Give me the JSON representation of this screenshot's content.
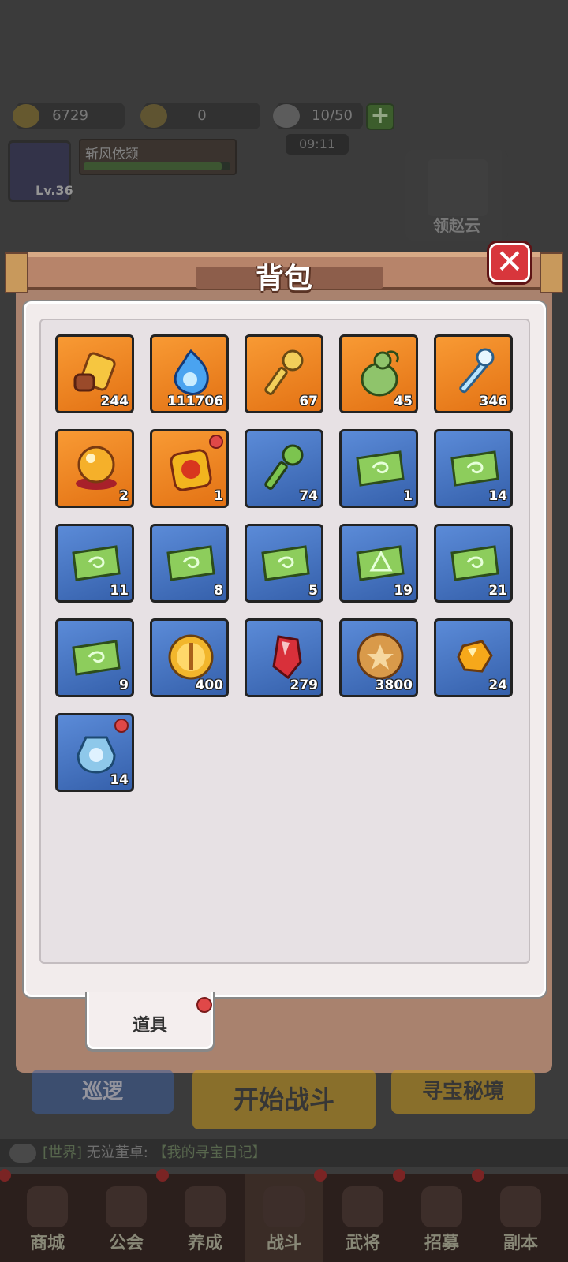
{
  "resources": {
    "gold": "6729",
    "ingot": "0",
    "stamina": "10/50",
    "timer": "09:11"
  },
  "player": {
    "level": "Lv.36",
    "name": "斩风依颖"
  },
  "hero": {
    "name": "领赵云"
  },
  "panel": {
    "title": "背包",
    "close_label": "✕",
    "tab_label": "道具"
  },
  "items": [
    {
      "icon": "golden-seal-icon",
      "qty": "244",
      "rarity": "orange",
      "has_dot": false
    },
    {
      "icon": "blue-spirit-flame-icon",
      "qty": "111706",
      "rarity": "orange",
      "has_dot": false
    },
    {
      "icon": "golden-key-icon",
      "qty": "67",
      "rarity": "orange",
      "has_dot": false
    },
    {
      "icon": "green-gourd-icon",
      "qty": "45",
      "rarity": "orange",
      "has_dot": false
    },
    {
      "icon": "ice-scepter-key-icon",
      "qty": "346",
      "rarity": "orange",
      "has_dot": false
    },
    {
      "icon": "fire-orb-icon",
      "qty": "2",
      "rarity": "orange",
      "has_dot": false
    },
    {
      "icon": "lucky-pouch-icon",
      "qty": "1",
      "rarity": "orange",
      "has_dot": true
    },
    {
      "icon": "jade-key-icon",
      "qty": "74",
      "rarity": "blue",
      "has_dot": false
    },
    {
      "icon": "green-scroll-icon",
      "qty": "1",
      "rarity": "blue",
      "has_dot": false
    },
    {
      "icon": "green-scroll-icon",
      "qty": "14",
      "rarity": "blue",
      "has_dot": false
    },
    {
      "icon": "green-scroll-icon",
      "qty": "11",
      "rarity": "blue",
      "has_dot": false
    },
    {
      "icon": "green-scroll-icon",
      "qty": "8",
      "rarity": "blue",
      "has_dot": false
    },
    {
      "icon": "green-scroll-icon",
      "qty": "5",
      "rarity": "blue",
      "has_dot": false
    },
    {
      "icon": "green-scroll-triangle-icon",
      "qty": "19",
      "rarity": "blue",
      "has_dot": false
    },
    {
      "icon": "green-scroll-icon",
      "qty": "21",
      "rarity": "blue",
      "has_dot": false
    },
    {
      "icon": "green-scroll-icon",
      "qty": "9",
      "rarity": "blue",
      "has_dot": false
    },
    {
      "icon": "gold-sword-medal-icon",
      "qty": "400",
      "rarity": "blue",
      "has_dot": false
    },
    {
      "icon": "red-crystal-icon",
      "qty": "279",
      "rarity": "blue",
      "has_dot": false
    },
    {
      "icon": "bronze-coin-icon",
      "qty": "3800",
      "rarity": "blue",
      "has_dot": false
    },
    {
      "icon": "amber-gem-icon",
      "qty": "24",
      "rarity": "blue",
      "has_dot": false
    },
    {
      "icon": "blue-pouch-icon",
      "qty": "14",
      "rarity": "blue",
      "has_dot": true
    }
  ],
  "bottom": {
    "patrol": "巡逻",
    "start_battle": "开始战斗",
    "treasure": "寻宝秘境"
  },
  "chat": {
    "channel": "[世界]",
    "sender": "无泣董卓:",
    "message": "【我的寻宝日记】"
  },
  "nav": [
    {
      "label": "商城",
      "icon": "shop-coin-icon"
    },
    {
      "label": "公会",
      "icon": "guild-shield-icon"
    },
    {
      "label": "养成",
      "icon": "growth-swirl-icon"
    },
    {
      "label": "战斗",
      "icon": "battle-swords-icon"
    },
    {
      "label": "武将",
      "icon": "general-helmet-icon"
    },
    {
      "label": "招募",
      "icon": "recruit-icon"
    },
    {
      "label": "副本",
      "icon": "dungeon-icon"
    }
  ]
}
